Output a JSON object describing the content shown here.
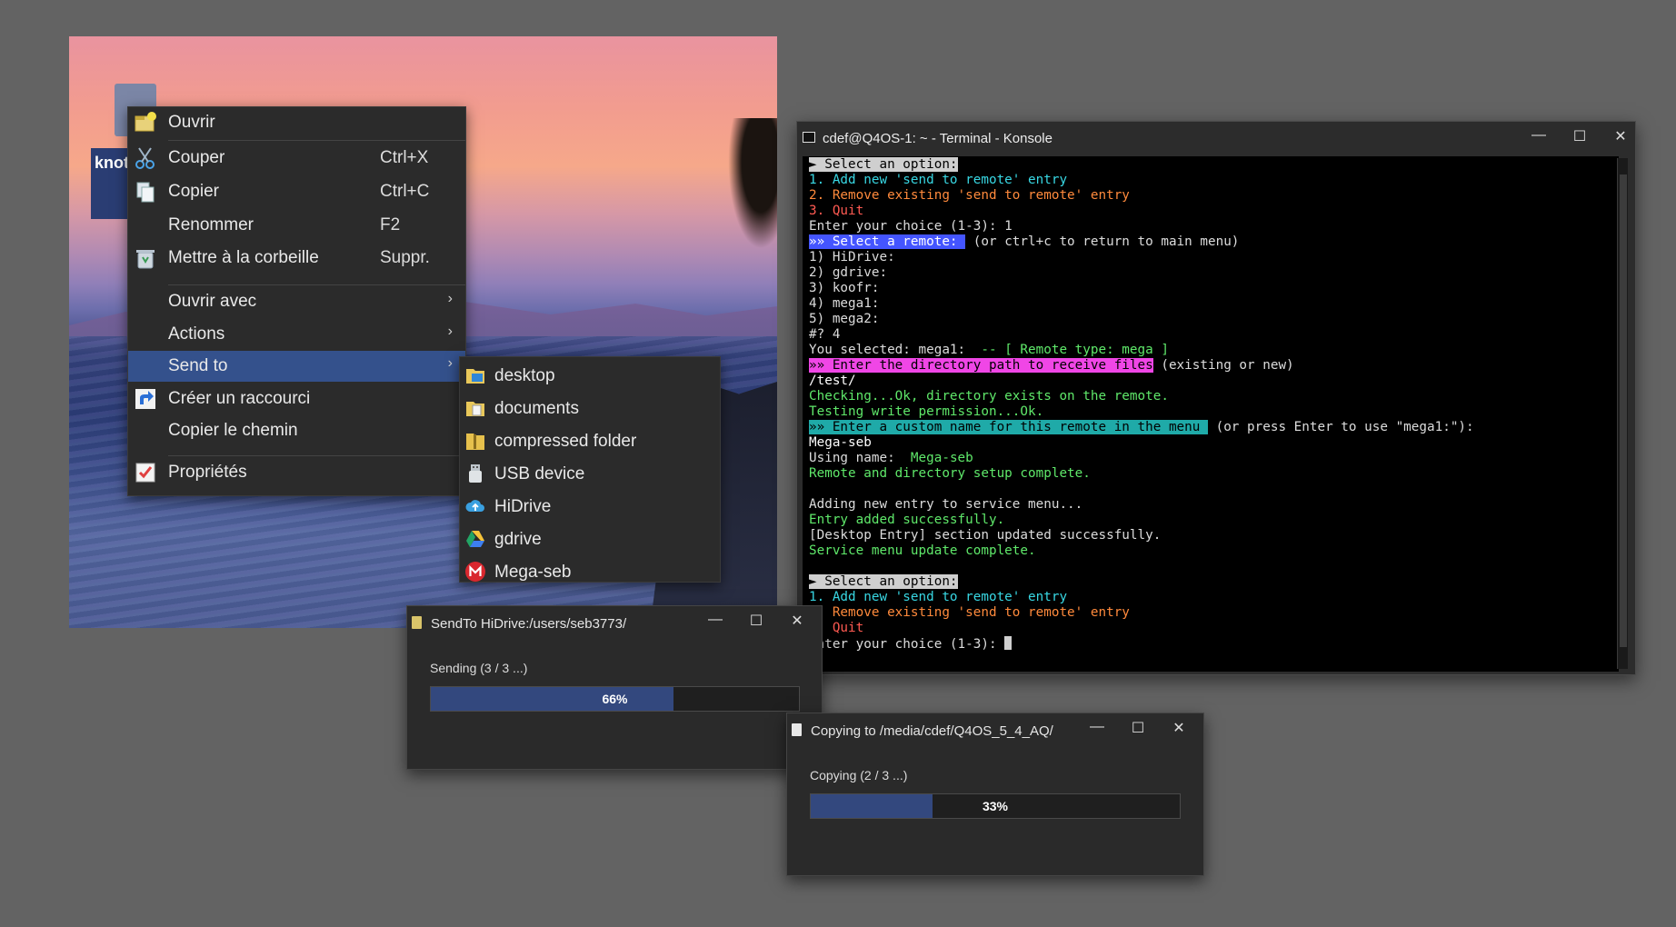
{
  "desktop": {
    "file_label": "knot"
  },
  "context_menu": {
    "items": [
      {
        "label": "Ouvrir",
        "shortcut": ""
      },
      {
        "label": "Couper",
        "shortcut": "Ctrl+X"
      },
      {
        "label": "Copier",
        "shortcut": "Ctrl+C"
      },
      {
        "label": "Renommer",
        "shortcut": "F2"
      },
      {
        "label": "Mettre à la corbeille",
        "shortcut": "Suppr."
      },
      {
        "label": "Ouvrir avec",
        "shortcut": ""
      },
      {
        "label": "Actions",
        "shortcut": ""
      },
      {
        "label": "Send to",
        "shortcut": ""
      },
      {
        "label": "Créer un raccourci",
        "shortcut": ""
      },
      {
        "label": "Copier le chemin",
        "shortcut": ""
      },
      {
        "label": "Propriétés",
        "shortcut": ""
      }
    ],
    "submenu_arrow": "›"
  },
  "send_to_menu": {
    "items": [
      {
        "label": "desktop",
        "icon": "folder-desktop-icon"
      },
      {
        "label": "documents",
        "icon": "folder-documents-icon"
      },
      {
        "label": "compressed folder",
        "icon": "zip-folder-icon"
      },
      {
        "label": "USB device",
        "icon": "usb-icon"
      },
      {
        "label": "HiDrive",
        "icon": "hidrive-icon"
      },
      {
        "label": "gdrive",
        "icon": "gdrive-icon"
      },
      {
        "label": "Mega-seb",
        "icon": "mega-icon"
      }
    ]
  },
  "terminal": {
    "title": "cdef@Q4OS-1: ~ - Terminal - Konsole",
    "lines": [
      {
        "segments": [
          {
            "text": "► Select an option:",
            "style": "h-gray"
          }
        ]
      },
      {
        "segments": [
          {
            "text": "1. Add new 'send to remote' entry",
            "style": "c-cyan"
          }
        ]
      },
      {
        "segments": [
          {
            "text": "2. Remove existing 'send to remote' entry",
            "style": "c-orange"
          }
        ]
      },
      {
        "segments": [
          {
            "text": "3. Quit",
            "style": "c-red"
          }
        ]
      },
      {
        "segments": [
          {
            "text": "Enter your choice (1-3): 1",
            "style": ""
          }
        ]
      },
      {
        "segments": [
          {
            "text": "»» Select a remote: ",
            "style": "h-blue"
          },
          {
            "text": " (or ctrl+c to return to main menu)",
            "style": ""
          }
        ]
      },
      {
        "segments": [
          {
            "text": "1) HiDrive:",
            "style": ""
          }
        ]
      },
      {
        "segments": [
          {
            "text": "2) gdrive:",
            "style": ""
          }
        ]
      },
      {
        "segments": [
          {
            "text": "3) koofr:",
            "style": ""
          }
        ]
      },
      {
        "segments": [
          {
            "text": "4) mega1:",
            "style": ""
          }
        ]
      },
      {
        "segments": [
          {
            "text": "5) mega2:",
            "style": ""
          }
        ]
      },
      {
        "segments": [
          {
            "text": "#? 4",
            "style": ""
          }
        ]
      },
      {
        "segments": [
          {
            "text": "You selected: mega1:  ",
            "style": ""
          },
          {
            "text": "-- [ Remote type: mega ]",
            "style": "c-green"
          }
        ]
      },
      {
        "segments": [
          {
            "text": "»» Enter the directory path to receive files",
            "style": "h-pink"
          },
          {
            "text": " (existing or new)",
            "style": ""
          }
        ]
      },
      {
        "segments": [
          {
            "text": "/test/",
            "style": "c-white"
          }
        ]
      },
      {
        "segments": [
          {
            "text": "Checking...Ok, directory exists on the remote.",
            "style": "c-green"
          }
        ]
      },
      {
        "segments": [
          {
            "text": "Testing write permission...Ok.",
            "style": "c-green"
          }
        ]
      },
      {
        "segments": [
          {
            "text": "»» Enter a custom name for this remote in the menu ",
            "style": "h-teal"
          },
          {
            "text": " (or press Enter to use \"mega1:\"):",
            "style": ""
          }
        ]
      },
      {
        "segments": [
          {
            "text": "Mega-seb",
            "style": "c-white"
          }
        ]
      },
      {
        "segments": [
          {
            "text": "Using name:  ",
            "style": ""
          },
          {
            "text": "Mega-seb",
            "style": "c-green"
          }
        ]
      },
      {
        "segments": [
          {
            "text": "Remote and directory setup complete.",
            "style": "c-green"
          }
        ]
      },
      {
        "segments": [
          {
            "text": "",
            "style": ""
          }
        ]
      },
      {
        "segments": [
          {
            "text": "Adding new entry to service menu...",
            "style": ""
          }
        ]
      },
      {
        "segments": [
          {
            "text": "Entry added successfully.",
            "style": "c-green"
          }
        ]
      },
      {
        "segments": [
          {
            "text": "[Desktop Entry] section updated successfully.",
            "style": ""
          }
        ]
      },
      {
        "segments": [
          {
            "text": "Service menu update complete.",
            "style": "c-green"
          }
        ]
      },
      {
        "segments": [
          {
            "text": "",
            "style": ""
          }
        ]
      },
      {
        "segments": [
          {
            "text": "► Select an option:",
            "style": "h-gray"
          }
        ]
      },
      {
        "segments": [
          {
            "text": "1. Add new 'send to remote' entry",
            "style": "c-cyan"
          }
        ]
      },
      {
        "segments": [
          {
            "text": "2. Remove existing 'send to remote' entry",
            "style": "c-orange"
          }
        ]
      },
      {
        "segments": [
          {
            "text": "3. Quit",
            "style": "c-red"
          }
        ]
      },
      {
        "segments": [
          {
            "text": "Enter your choice (1-3): ",
            "style": ""
          }
        ]
      }
    ]
  },
  "dialog_hidrive": {
    "title": "SendTo HiDrive:/users/seb3773/",
    "status": "Sending (3 / 3 ...)",
    "progress": 0.66,
    "progress_label": "66%"
  },
  "dialog_copy": {
    "title": "Copying to /media/cdef/Q4OS_5_4_AQ/",
    "status": "Copying (2 / 3 ...)",
    "progress": 0.33,
    "progress_label": "33%"
  },
  "window_buttons": {
    "minimize": "—",
    "maximize": "☐",
    "close": "✕"
  },
  "colors": {
    "menu_highlight": "#34518c",
    "progress_fill": "#33487e",
    "terminal_bg": "#000000"
  }
}
